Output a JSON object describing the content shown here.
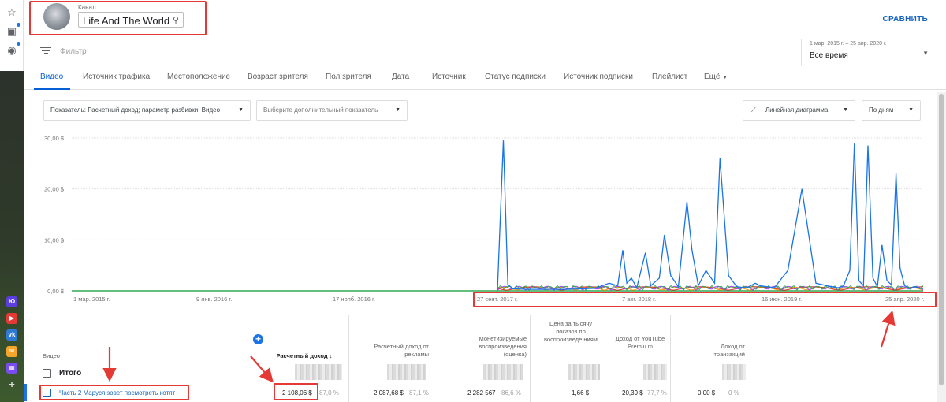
{
  "header": {
    "channel_label": "Канал",
    "channel_value": "Life And The World",
    "compare_label": "СРАВНИТЬ"
  },
  "filter": {
    "placeholder": "Фильтр",
    "date_range": "1 мар. 2015 г. – 25 апр. 2020 г.",
    "period": "Все время"
  },
  "tabs": [
    "Видео",
    "Источник трафика",
    "Местоположение",
    "Возраст зрителя",
    "Пол зрителя",
    "Дата",
    "Источник",
    "Статус подписки",
    "Источник подписки",
    "Плейлист",
    "Ещё"
  ],
  "controls": {
    "metric": "Показатель: Расчетный доход; параметр разбивки: Видео",
    "extra_metric": "Выберите дополнительный показатель",
    "chart_type": "Линейная диаграмма",
    "granularity": "По дням"
  },
  "chart_data": {
    "type": "line",
    "y_ticks": [
      "0,00 $",
      "10,00 $",
      "20,00 $",
      "30,00 $"
    ],
    "x_ticks": [
      "1 мар. 2015 г.",
      "9 янв. 2016 г.",
      "17 нояб. 2016 г.",
      "27 сент. 2017 г.",
      "7 авг. 2018 г.",
      "16 июн. 2019 г.",
      "25 апр. 2020 г."
    ],
    "ylim": [
      0,
      30
    ],
    "colors": {
      "main": "#1a73e8",
      "green": "#34a853",
      "orange": "#f29900",
      "red": "#d93025",
      "purple": "#a142f4"
    },
    "main_series": {
      "x": [
        "2017-09-27",
        "2017-10-10",
        "2017-10-20",
        "2017-11-01",
        "2017-12-01",
        "2018-01-01",
        "2018-03-01",
        "2018-05-01",
        "2018-06-01",
        "2018-06-20",
        "2018-07-01",
        "2018-07-10",
        "2018-07-20",
        "2018-08-01",
        "2018-08-20",
        "2018-09-01",
        "2018-09-20",
        "2018-10-01",
        "2018-10-15",
        "2018-11-01",
        "2018-11-20",
        "2018-12-01",
        "2018-12-15",
        "2019-01-01",
        "2019-01-20",
        "2019-02-01",
        "2019-02-20",
        "2019-03-10",
        "2019-04-01",
        "2019-04-20",
        "2019-05-01",
        "2019-06-01",
        "2019-07-01",
        "2019-08-01",
        "2019-09-01",
        "2019-10-01",
        "2019-10-20",
        "2019-11-01",
        "2019-11-15",
        "2019-11-25",
        "2019-12-05",
        "2019-12-15",
        "2019-12-25",
        "2020-01-05",
        "2020-01-15",
        "2020-01-25",
        "2020-02-05",
        "2020-02-15",
        "2020-02-25",
        "2020-03-05",
        "2020-03-15",
        "2020-03-25",
        "2020-04-05",
        "2020-04-15",
        "2020-04-25"
      ],
      "values": [
        0.1,
        29.5,
        1.2,
        0.4,
        0.3,
        0.3,
        0.3,
        0.5,
        1.5,
        1.0,
        8.0,
        1.5,
        2.5,
        0.6,
        7.5,
        1.0,
        2.5,
        11.0,
        3.0,
        0.8,
        17.5,
        8.0,
        1.0,
        4.0,
        1.5,
        26.0,
        3.0,
        0.8,
        0.6,
        1.5,
        1.0,
        0.6,
        4.0,
        20.0,
        1.5,
        0.9,
        0.6,
        1.0,
        4.0,
        29.0,
        2.0,
        1.0,
        28.5,
        2.5,
        0.8,
        9.0,
        2.0,
        1.2,
        23.0,
        4.5,
        1.0,
        0.5,
        0.8,
        0.6,
        0.4
      ]
    }
  },
  "table": {
    "headers": {
      "video": "Видео",
      "revenue": "Расчетный доход",
      "ad_revenue": "Расчетный доход от рекламы",
      "monetized": "Монетизируемые воспроизведения (оценка)",
      "cpm": "Цена за тысячу показов по воспроизведе ниям",
      "premium": "Доход от YouTube Premiu m",
      "transactions": "Доход от транзакций"
    },
    "total_label": "Итого",
    "row": {
      "title": "Часть 2 Маруся зовет посмотреть котят",
      "revenue": "2 108,06 $",
      "revenue_pct": "87,0 %",
      "ad_revenue": "2 087,68 $",
      "ad_revenue_pct": "87,1 %",
      "monetized": "2 282 567",
      "monetized_pct": "86,6 %",
      "cpm": "1,66 $",
      "premium": "20,39 $",
      "premium_pct": "77,7 %",
      "transactions": "0,00 $",
      "transactions_pct": "0 %"
    }
  },
  "rail_apps": [
    "Юрат",
    "youtube",
    "vk",
    "mail",
    "calendar"
  ]
}
